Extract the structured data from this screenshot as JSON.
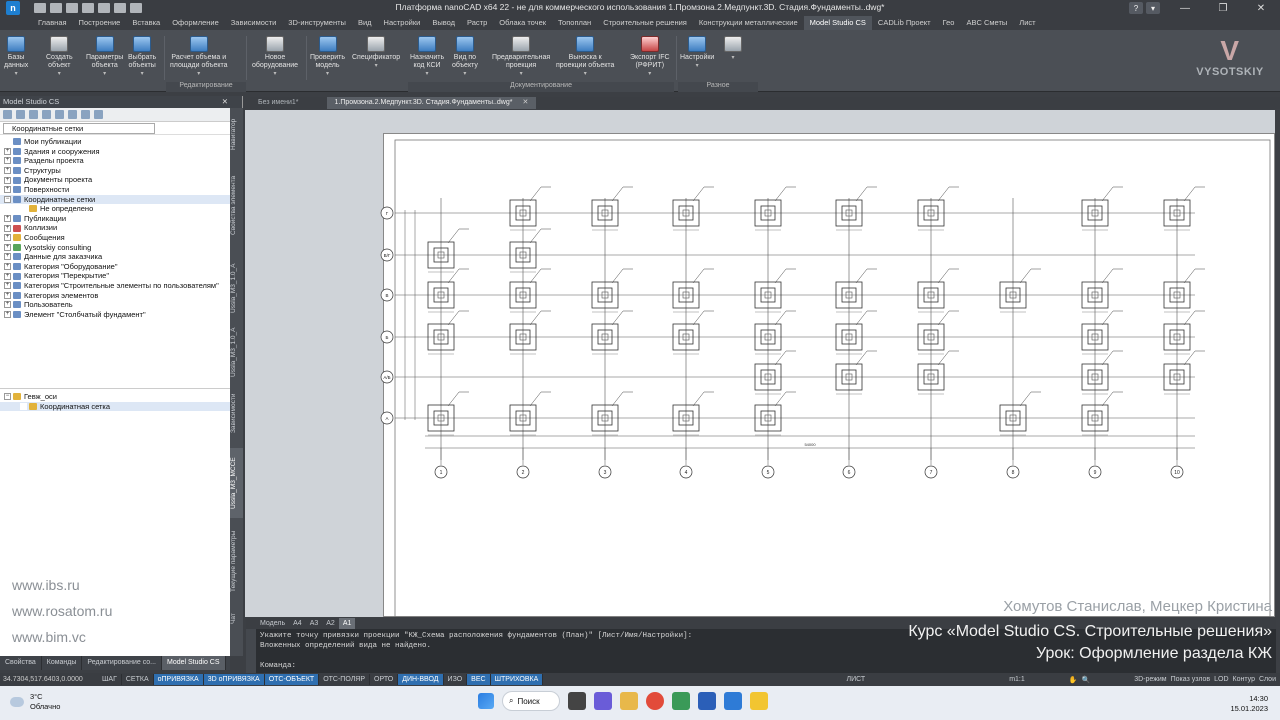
{
  "window": {
    "title": "Платформа nanoCAD x64 22 - не для коммерческого использования 1.Промзона.2.Медпункт.3D. Стадия.Фундаменты..dwg*",
    "minimize": "—",
    "maximize": "❐",
    "close": "✕"
  },
  "ribbon_tabs": [
    "Главная",
    "Построение",
    "Вставка",
    "Оформление",
    "Зависимости",
    "3D-инструменты",
    "Вид",
    "Настройки",
    "Вывод",
    "Растр",
    "Облака точек",
    "Топоплан",
    "Строительные решения",
    "Конструкции металлические",
    "Model Studio CS",
    "CADLib Проект",
    "Гео",
    "ABC Сметы",
    "Лист"
  ],
  "active_ribbon_tab": "Model Studio CS",
  "ribbon_buttons": [
    {
      "l1": "Базы",
      "l2": "данных"
    },
    {
      "l1": "Создать",
      "l2": "объект"
    },
    {
      "l1": "Параметры",
      "l2": "объекта"
    },
    {
      "l1": "Выбрать",
      "l2": "объекты"
    },
    {
      "l1": "Расчет объема и",
      "l2": "площади объекта"
    },
    {
      "l1": "Новое",
      "l2": "оборудование"
    },
    {
      "l1": "Проверить",
      "l2": "модель"
    },
    {
      "l1": "Спецификатор",
      "l2": ""
    },
    {
      "l1": "Назначить",
      "l2": "код КСИ"
    },
    {
      "l1": "Вид по",
      "l2": "объекту"
    },
    {
      "l1": "Предварительная",
      "l2": "проекция"
    },
    {
      "l1": "Выноска к",
      "l2": "проекции объекта"
    },
    {
      "l1": "Экспорт IFC",
      "l2": "(РФРИТ)"
    },
    {
      "l1": "Настройки",
      "l2": ""
    }
  ],
  "ribbon_groups": {
    "edit": "Редактирование",
    "docs": "Документирование",
    "misc": "Разное"
  },
  "logo_text": "VYSOTSKIY",
  "left_panel": {
    "title": "Model Studio CS",
    "close": "✕",
    "filter_value": "Координатные сетки",
    "tree": [
      {
        "label": "Мои публикации",
        "exp": "",
        "icon": "b"
      },
      {
        "label": "Здания и сооружения",
        "exp": "+",
        "icon": "b"
      },
      {
        "label": "Разделы проекта",
        "exp": "+",
        "icon": "b"
      },
      {
        "label": "Структуры",
        "exp": "+",
        "icon": "b"
      },
      {
        "label": "Документы проекта",
        "exp": "+",
        "icon": "b"
      },
      {
        "label": "Поверхности",
        "exp": "+",
        "icon": "b"
      },
      {
        "label": "Координатные сетки",
        "exp": "−",
        "icon": "b",
        "sel": true
      },
      {
        "label": "Не определено",
        "exp": "",
        "icon": "y",
        "indent": true
      },
      {
        "label": "Публикации",
        "exp": "+",
        "icon": "b"
      },
      {
        "label": "Коллизии",
        "exp": "+",
        "icon": "r"
      },
      {
        "label": "Сообщения",
        "exp": "+",
        "icon": "y"
      },
      {
        "label": "Vysotskiy consulting",
        "exp": "+",
        "icon": "g"
      },
      {
        "label": "Данные для заказчика",
        "exp": "+",
        "icon": "b"
      },
      {
        "label": "Категория \"Оборудование\"",
        "exp": "+",
        "icon": "b"
      },
      {
        "label": "Категория \"Перекрытие\"",
        "exp": "+",
        "icon": "b"
      },
      {
        "label": "Категория \"Строительные элементы по пользователям\"",
        "exp": "+",
        "icon": "b"
      },
      {
        "label": "Категория элементов",
        "exp": "+",
        "icon": "b"
      },
      {
        "label": "Пользователь",
        "exp": "+",
        "icon": "b"
      },
      {
        "label": "Элемент \"Столбчатый фундамент\"",
        "exp": "+",
        "icon": "b"
      }
    ],
    "props_tree": [
      {
        "label": "Гевж_оси",
        "exp": "−",
        "icon": "y"
      },
      {
        "label": "Координатная сетка",
        "exp": "",
        "icon": "y",
        "indent": true,
        "sel": true
      }
    ],
    "watermarks": [
      "www.ibs.ru",
      "www.rosatom.ru",
      "www.bim.vc"
    ],
    "bottom_tabs": [
      "Свойства",
      "Команды",
      "Редактирование со...",
      "Model Studio CS"
    ],
    "active_bottom_tab": "Model Studio CS"
  },
  "side_tabs": [
    "Навигатор",
    "Свойства элемента",
    "Ussla_М3_1.0_А",
    "Ussla_М3_1.0_А",
    "Зависимости",
    "Ussla_М3_МССЕ",
    "Текущие параметры",
    "Чат"
  ],
  "doc_tabs": [
    {
      "label": "Без имени1*",
      "active": false
    },
    {
      "label": "1.Промзона.2.Медпункт.3D. Стадия.Фундаменты..dwg*",
      "active": true,
      "close": "✕"
    }
  ],
  "drawing": {
    "col_labels": [
      "1",
      "2",
      "3",
      "4",
      "5",
      "6",
      "7",
      "8",
      "9",
      "10"
    ],
    "row_labels": [
      "Г",
      "В/Г",
      "В",
      "Б",
      "А/Б",
      "А"
    ],
    "overall_dim": "54000"
  },
  "layout_tabs": [
    "Модель",
    "A4",
    "A3",
    "A2",
    "A1"
  ],
  "active_layout_tab": "A1",
  "overlay": {
    "authors": "Хомутов Станислав, Мецкер Кристина",
    "course": "Курс «Model Studio CS. Строительные решения»",
    "lesson": "Урок: Оформление раздела КЖ"
  },
  "command_line": [
    "Укажите точку привязки проекции \"КЖ_Схема расположения фундаментов (План)\" [Лист/Имя/Настройки]:",
    "Вложенных определений вида не найдено.",
    "",
    "Команда:"
  ],
  "statusbar": {
    "coords": "34.7304,517.6403,0.0000",
    "buttons": [
      {
        "l": "ШАГ",
        "on": false
      },
      {
        "l": "СЕТКА",
        "on": false
      },
      {
        "l": "оПРИВЯЗКА",
        "on": true
      },
      {
        "l": "3D оПРИВЯЗКА",
        "on": true
      },
      {
        "l": "ОТС-ОБЪЕКТ",
        "on": true
      },
      {
        "l": "ОТС-ПОЛЯР",
        "on": false
      },
      {
        "l": "ОРТО",
        "on": false
      },
      {
        "l": "ДИН-ВВОД",
        "on": true
      },
      {
        "l": "ИЗО",
        "on": false
      },
      {
        "l": "ВЕС",
        "on": true
      },
      {
        "l": "ШТРИХОВКА",
        "on": true
      }
    ],
    "sheet": "ЛИСТ",
    "scale": "m1:1",
    "right": [
      "3D-режим",
      "Показ узлов",
      "LOD",
      "Контур",
      "Слои"
    ]
  },
  "taskbar": {
    "temp": "3°C",
    "weather": "Облачно",
    "search": "Поиск",
    "time": "14:30",
    "date": "15.01.2023"
  }
}
